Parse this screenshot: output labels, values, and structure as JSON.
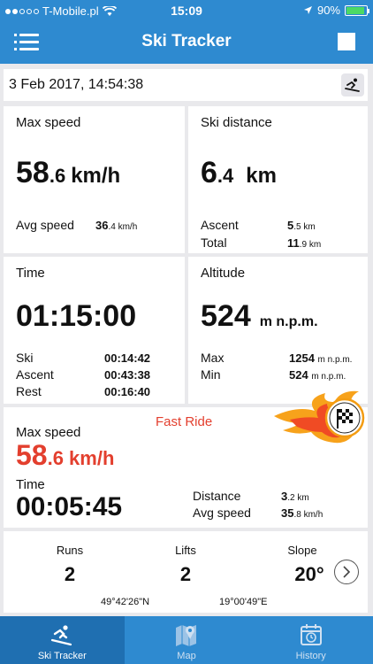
{
  "status_bar": {
    "carrier": "T-Mobile.pl",
    "time": "15:09",
    "battery": "90%",
    "battery_level": 0.9
  },
  "nav": {
    "title": "Ski Tracker",
    "menu_icon": "hamburger-menu-icon",
    "stop_icon": "stop-square-icon"
  },
  "session": {
    "date": "3 Feb 2017, 14:54:38",
    "mode_icon": "skier-icon"
  },
  "speed": {
    "label": "Max speed",
    "value_int": "58",
    "value_dec": ".6",
    "unit": "km/h",
    "avg_label": "Avg speed",
    "avg_int": "36",
    "avg_dec": ".4 km/h"
  },
  "distance": {
    "label": "Ski distance",
    "value_int": "6",
    "value_dec": ".4",
    "unit": "km",
    "ascent_label": "Ascent",
    "ascent_int": "5",
    "ascent_dec": ".5 km",
    "total_label": "Total",
    "total_int": "11",
    "total_dec": ".9 km"
  },
  "time": {
    "label": "Time",
    "value": "01:15:00",
    "ski_label": "Ski",
    "ski_value": "00:14:42",
    "ascent_label": "Ascent",
    "ascent_value": "00:43:38",
    "rest_label": "Rest",
    "rest_value": "00:16:40"
  },
  "altitude": {
    "label": "Altitude",
    "value": "524",
    "unit": "m n.p.m.",
    "max_label": "Max",
    "max_value": "1254",
    "max_unit": "m n.p.m.",
    "min_label": "Min",
    "min_value": "524",
    "min_unit": "m n.p.m."
  },
  "fast_ride": {
    "title": "Fast Ride",
    "speed_label": "Max speed",
    "speed_int": "58",
    "speed_dec": ".6 km/h",
    "time_label": "Time",
    "time_value": "00:05:45",
    "distance_label": "Distance",
    "distance_int": "3",
    "distance_dec": ".2 km",
    "avg_label": "Avg speed",
    "avg_int": "35",
    "avg_dec": ".8 km/h",
    "badge_icon": "checkered-flag-flame-icon"
  },
  "stats": {
    "runs_label": "Runs",
    "runs_value": "2",
    "lifts_label": "Lifts",
    "lifts_value": "2",
    "slope_label": "Slope",
    "slope_value": "20°",
    "lat": "49°42'26\"N",
    "lon": "19°00'49\"E",
    "next_icon": "chevron-right-circle-icon"
  },
  "tabs": [
    {
      "label": "Ski Tracker",
      "icon": "skier-icon",
      "active": true
    },
    {
      "label": "Map",
      "icon": "map-pin-icon",
      "active": false
    },
    {
      "label": "History",
      "icon": "calendar-clock-icon",
      "active": false
    }
  ],
  "colors": {
    "primary": "#2e8ad0",
    "accent_red": "#e33f2e",
    "background": "#e9e9ec"
  }
}
